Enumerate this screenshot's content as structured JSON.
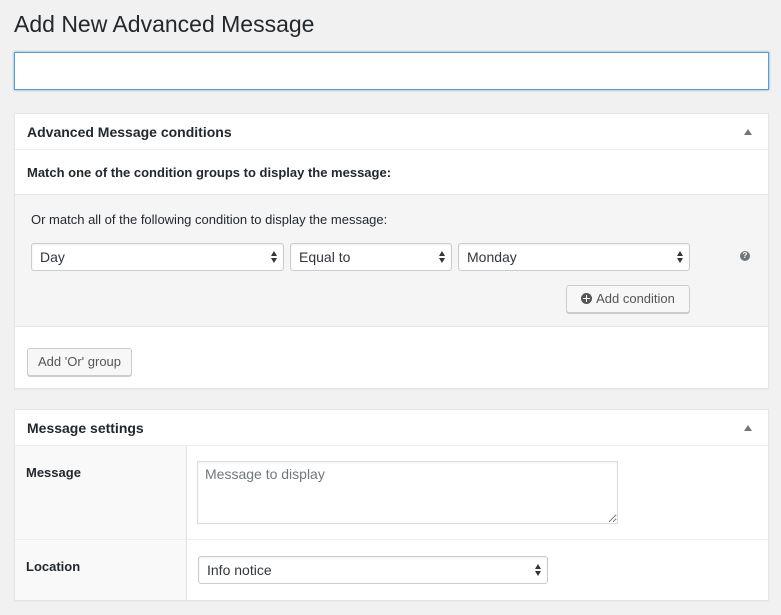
{
  "page": {
    "title": "Add New Advanced Message",
    "title_value": ""
  },
  "conditions_box": {
    "title": "Advanced Message conditions",
    "match_text": "Match one of the condition groups to display the message:",
    "group": {
      "text": "Or match all of the following condition to display the message:",
      "condition": {
        "field": "Day",
        "operator": "Equal to",
        "value": "Monday"
      },
      "help_icon": "question-icon",
      "add_condition_label": "Add condition"
    },
    "add_or_group_label": "Add 'Or' group"
  },
  "settings_box": {
    "title": "Message settings",
    "message_label": "Message",
    "message_placeholder": "Message to display",
    "location_label": "Location",
    "location_value": "Info notice"
  }
}
